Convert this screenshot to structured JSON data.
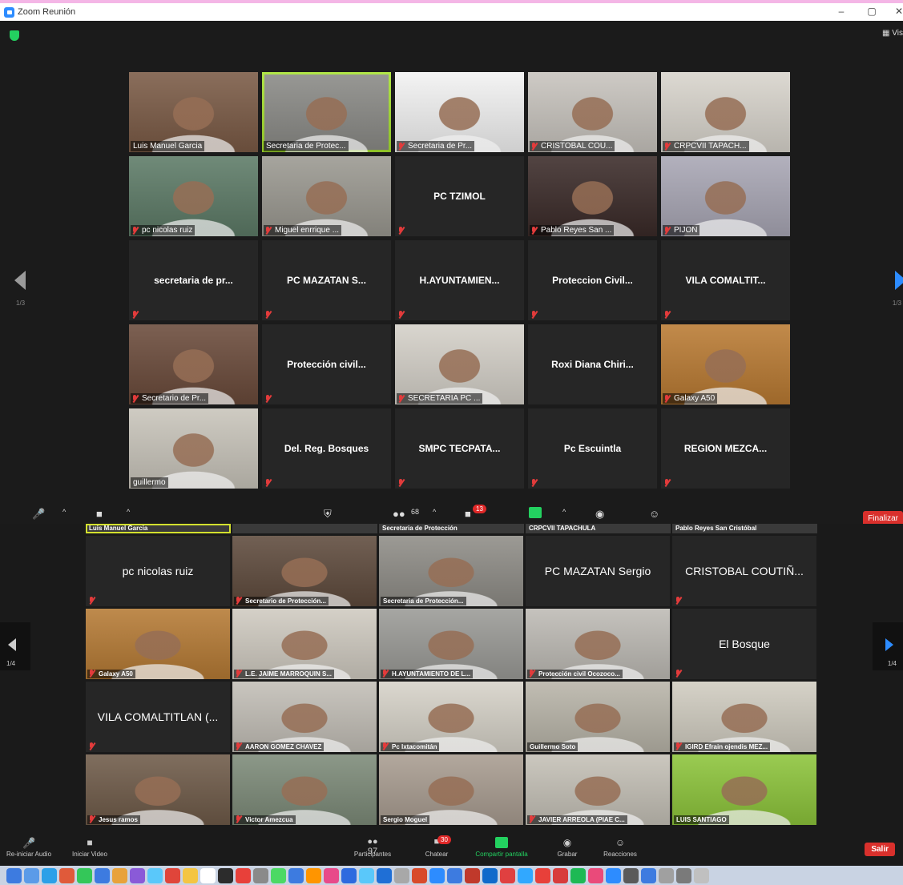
{
  "window": {
    "title": "Zoom Reunión",
    "minimize": "–",
    "maximize": "▢",
    "close": "✕",
    "view_label": "Vis"
  },
  "top_grid": {
    "page_left": "1/3",
    "page_right": "1/3",
    "tiles": [
      {
        "name": "Luis Manuel Garcia",
        "video": true,
        "muted": false,
        "color": "#7a5a45"
      },
      {
        "name": "Secretaria de Protec...",
        "video": true,
        "muted": false,
        "active": true,
        "color": "#8a8a86"
      },
      {
        "name": "Secretaria de Pr...",
        "video": true,
        "muted": true,
        "color": "#f2f2f2"
      },
      {
        "name": "CRISTOBAL COU...",
        "video": true,
        "muted": true,
        "color": "#c7c3bd"
      },
      {
        "name": "CRPCVII TAPACH...",
        "video": true,
        "muted": true,
        "color": "#d8d4cc"
      },
      {
        "name": "pc nicolas ruiz",
        "video": true,
        "muted": true,
        "color": "#5c7a66"
      },
      {
        "name": "Miguel enrrique ...",
        "video": true,
        "muted": true,
        "color": "#9a9890"
      },
      {
        "name": "PC TZIMOL",
        "video": false,
        "muted": true,
        "centered": true
      },
      {
        "name": "Pablo Reyes San ...",
        "video": true,
        "muted": true,
        "color": "#3a2a28"
      },
      {
        "name": "PIJON",
        "video": true,
        "muted": true,
        "color": "#a8a6b4"
      },
      {
        "name": "secretaria de pr...",
        "video": false,
        "muted": true
      },
      {
        "name": "PC MAZATAN S...",
        "video": false,
        "muted": true
      },
      {
        "name": "H.AYUNTAMIEN...",
        "video": false,
        "muted": true
      },
      {
        "name": "Proteccion Civil...",
        "video": false,
        "muted": true
      },
      {
        "name": "VILA COMALTIT...",
        "video": false,
        "muted": true
      },
      {
        "name": "Secretario de Pr...",
        "video": true,
        "muted": true,
        "color": "#6a4a3a"
      },
      {
        "name": "Protección civil...",
        "video": false,
        "muted": true
      },
      {
        "name": "SECRETARIA PC ...",
        "video": true,
        "muted": true,
        "color": "#d4d0c8"
      },
      {
        "name": "Roxi Diana Chiri...",
        "video": false,
        "muted": false
      },
      {
        "name": "Galaxy A50",
        "video": true,
        "muted": true,
        "color": "#b97a32"
      },
      {
        "name": "guillermo",
        "video": true,
        "muted": false,
        "color": "#c8c4ba"
      },
      {
        "name": "Del. Reg. Bosques",
        "video": false,
        "muted": true
      },
      {
        "name": "SMPC TECPATA...",
        "video": false,
        "muted": true
      },
      {
        "name": "Pc Escuintla",
        "video": false,
        "muted": true
      },
      {
        "name": "REGION MEZCA...",
        "video": false,
        "muted": true
      }
    ]
  },
  "top_toolbar": {
    "participants_count": "68",
    "chat_badge": "13",
    "end_label": "Finalizar"
  },
  "bottom_strip": [
    "Luis Manuel Garcia",
    "",
    "Secretaria de Protección",
    "CRPCVII TAPACHULA",
    "Pablo Reyes San Cristóbal"
  ],
  "bottom_grid": {
    "page_left": "1/4",
    "page_right": "1/4",
    "tiles": [
      {
        "name": "pc nicolas ruiz",
        "video": false,
        "muted": true
      },
      {
        "name": "Secretario de Protección...",
        "video": true,
        "muted": true,
        "color": "#5e4a3c"
      },
      {
        "name": "Secretaria de Protección...",
        "video": true,
        "muted": false,
        "color": "#8e8c86"
      },
      {
        "name": "PC MAZATAN Sergio",
        "video": false,
        "muted": false
      },
      {
        "name": "CRISTOBAL COUTIÑ...",
        "video": false,
        "muted": true
      },
      {
        "name": "Galaxy A50",
        "video": true,
        "muted": true,
        "color": "#b57a34"
      },
      {
        "name": "L.E. JAIME MARROQUIN S...",
        "video": true,
        "muted": true,
        "color": "#cfcac0"
      },
      {
        "name": "H.AYUNTAMIENTO DE L...",
        "video": true,
        "muted": true,
        "color": "#9a9a96"
      },
      {
        "name": "Protección civil Ocozoco...",
        "video": true,
        "muted": true,
        "color": "#bdbab4"
      },
      {
        "name": "El Bosque",
        "video": false,
        "muted": true
      },
      {
        "name": "VILA COMALTITLAN (...",
        "video": false,
        "muted": true
      },
      {
        "name": "AARON GOMEZ CHAVEZ",
        "video": true,
        "muted": true,
        "color": "#c2beb6"
      },
      {
        "name": "Pc Ixtacomitán",
        "video": true,
        "muted": true,
        "color": "#d6d2c8"
      },
      {
        "name": "Guillermo Soto",
        "video": true,
        "muted": false,
        "color": "#b8b4a8"
      },
      {
        "name": "IGIRD Efrain ojendis MEZ...",
        "video": true,
        "muted": true,
        "color": "#d0ccc0"
      },
      {
        "name": "Jesus ramos",
        "video": true,
        "muted": true,
        "color": "#6e5a48"
      },
      {
        "name": "Victor Amezcua",
        "video": true,
        "muted": true,
        "color": "#7c8a78"
      },
      {
        "name": "Sergio Moguel",
        "video": true,
        "muted": false,
        "color": "#a89c90"
      },
      {
        "name": "JAVIER ARREOLA (PIAE C...",
        "video": true,
        "muted": true,
        "color": "#c4c0b6"
      },
      {
        "name": "LUIS SANTIAGO",
        "video": true,
        "muted": false,
        "color": "#8cc43a"
      }
    ]
  },
  "bottom_toolbar": {
    "audio_label": "Re-iniciar Audio",
    "video_label": "Iniciar Video",
    "participants_label": "Participantes",
    "participants_count": "97",
    "chat_label": "Chatear",
    "chat_badge": "30",
    "share_label": "Compartir pantalla",
    "record_label": "Grabar",
    "reactions_label": "Reacciones",
    "leave_label": "Salir"
  },
  "dock_apps": [
    "#3d7be0",
    "#5b9be8",
    "#2ba0e8",
    "#e05a3a",
    "#34c759",
    "#3d7be0",
    "#e8a23a",
    "#8a5ad8",
    "#5ac8fa",
    "#e0453a",
    "#f4c542",
    "#ffffff",
    "#2c2c2c",
    "#e8403a",
    "#8a8a8a",
    "#4cd964",
    "#3d7be0",
    "#ff9500",
    "#e84a8a",
    "#2d6adf",
    "#5ac8fa",
    "#1f6fd6",
    "#a8a8a8",
    "#d84a2a",
    "#2d8cff",
    "#3d7be0",
    "#c0392b",
    "#0f6acb",
    "#e04040",
    "#31a8ff",
    "#e8403a",
    "#d83b3b",
    "#1db954",
    "#ea4a7a",
    "#2d8cff",
    "#5a5a5a",
    "#3d7be0",
    "#a0a0a0",
    "#7a7a7a",
    "#c0c0c0"
  ]
}
